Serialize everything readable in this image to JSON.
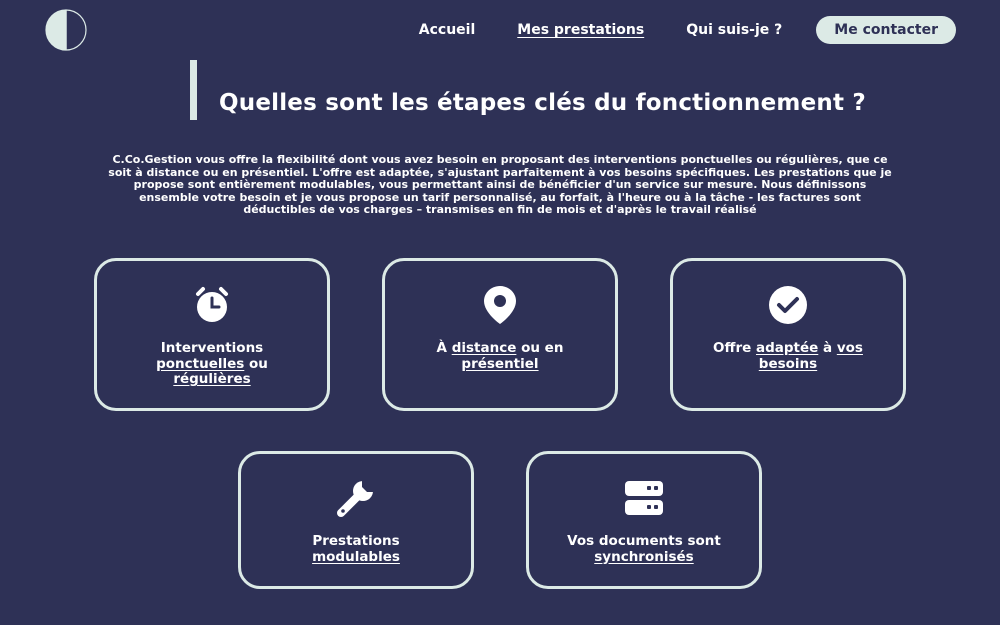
{
  "nav": {
    "items": [
      {
        "label": "Accueil"
      },
      {
        "label": "Mes prestations"
      },
      {
        "label": "Qui suis-je ?"
      }
    ],
    "contact_label": "Me contacter"
  },
  "heading": {
    "title": "Quelles sont les étapes clés du fonctionnement ?",
    "intro": "C.Co.Gestion vous offre la flexibilité dont vous avez besoin en proposant des interventions ponctuelles ou régulières, que ce soit à distance ou en présentiel. L'offre est adaptée, s'ajustant parfaitement à vos besoins spécifiques. Les prestations que je propose sont entièrement modulables, vous permettant ainsi de bénéficier d'un service sur mesure. Nous définissons ensemble votre besoin et je vous propose un tarif personnalisé, au forfait, à l'heure ou à la tâche - les factures sont déductibles de vos charges – transmises en fin de mois et d'après le travail réalisé"
  },
  "cards": [
    {
      "icon": "alarm-clock-icon",
      "p1": "Interventions",
      "p2": "ponctuelles",
      "p3": " ou",
      "p4": "régulières"
    },
    {
      "icon": "location-pin-icon",
      "p1": "À ",
      "p2": "distance",
      "p3": " ou en",
      "p4": "présentiel"
    },
    {
      "icon": "check-circle-icon",
      "p1": "Offre ",
      "p2": "adaptée",
      "p3": " à ",
      "p4": "vos",
      "p5": "besoins"
    },
    {
      "icon": "wrench-icon",
      "p1": "Prestations",
      "p2": "modulables"
    },
    {
      "icon": "server-icon",
      "p1": "Vos documents sont",
      "p2": "synchronisés"
    }
  ],
  "colors": {
    "background": "#2e3156",
    "accent": "#dceae6",
    "text": "#ffffff"
  }
}
